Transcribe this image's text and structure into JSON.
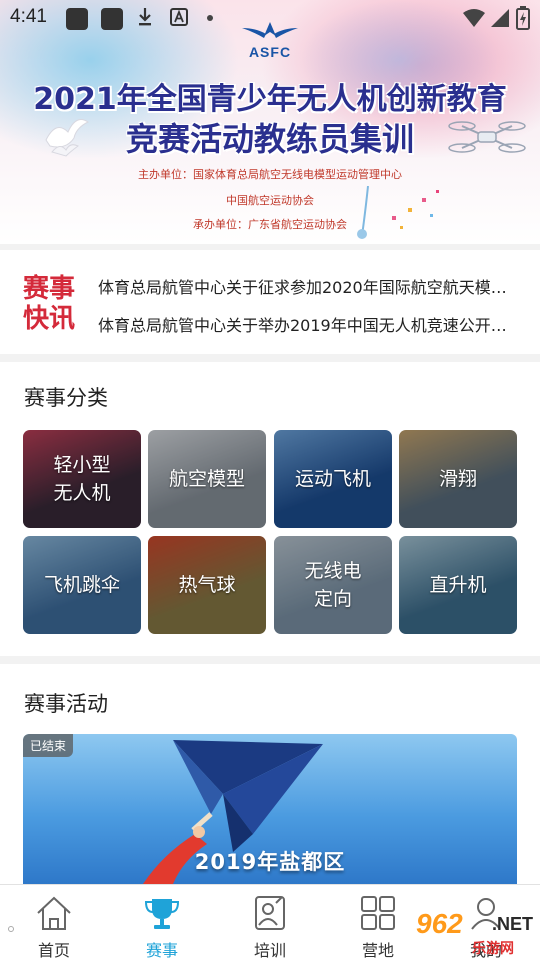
{
  "status_bar": {
    "time": "4:41"
  },
  "banner": {
    "logo_text": "ASFC",
    "title_line1": "2021年全国青少年无人机创新教育",
    "title_line2": "竞赛活动教练员集训",
    "line1": "主办单位：国家体育总局航空无线电模型运动管理中心",
    "line2": "中国航空运动协会",
    "line3": "承办单位：广东省航空运动协会"
  },
  "news": {
    "logo_line1": "赛事",
    "logo_line2": "快讯",
    "items": [
      "体育总局航管中心关于征求参加2020年国际航空航天模…",
      "体育总局航管中心关于举办2019年中国无人机竞速公开…"
    ]
  },
  "categories": {
    "title": "赛事分类",
    "items": [
      {
        "label": "轻小型\n无人机",
        "bg": "#3a2a3a",
        "accent": "#c0405a"
      },
      {
        "label": "航空模型",
        "bg": "#8a939c",
        "accent": "#d9dde2"
      },
      {
        "label": "运动飞机",
        "bg": "#1d4f93",
        "accent": "#6fa6e0"
      },
      {
        "label": "滑翔",
        "bg": "#5a6e7e",
        "accent": "#c8a670"
      },
      {
        "label": "飞机跳伞",
        "bg": "#3f6fa0",
        "accent": "#8fbce0"
      },
      {
        "label": "热气球",
        "bg": "#8a7a46",
        "accent": "#d24a2e"
      },
      {
        "label": "无线电\n定向",
        "bg": "#7d94a8",
        "accent": "#bcc9d4"
      },
      {
        "label": "直升机",
        "bg": "#3e6f8f",
        "accent": "#a8c8d8"
      }
    ]
  },
  "activities": {
    "title": "赛事活动",
    "badge": "已结束",
    "banner_title": "2019年盐都区"
  },
  "bottom_nav": {
    "active": "赛事",
    "items": [
      {
        "label": "首页",
        "icon": "home-icon"
      },
      {
        "label": "赛事",
        "icon": "trophy-icon"
      },
      {
        "label": "培训",
        "icon": "training-icon"
      },
      {
        "label": "营地",
        "icon": "camp-icon"
      },
      {
        "label": "我的",
        "icon": "profile-icon"
      }
    ]
  },
  "watermark": {
    "num": "962",
    "net": ".NET",
    "sub": "乐游网"
  },
  "colors": {
    "accent": "#1fa3d8",
    "news_red": "#d42a3a",
    "title_blue": "#2a2f8f"
  }
}
